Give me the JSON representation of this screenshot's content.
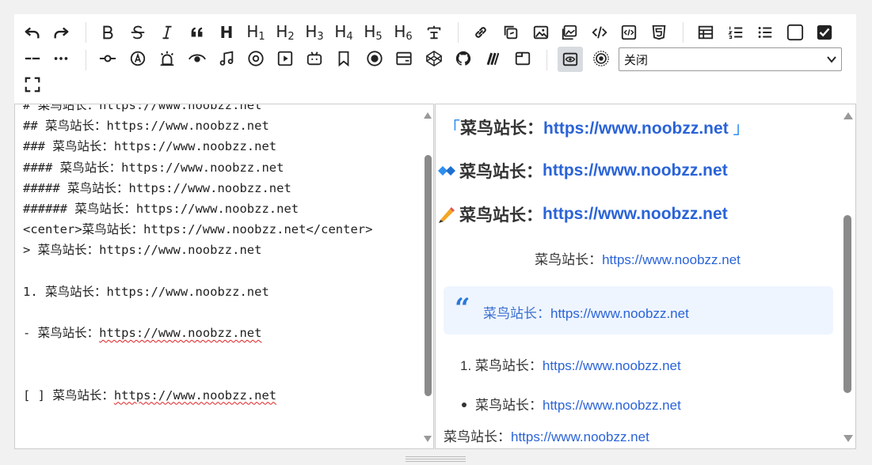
{
  "toolbar": {
    "mode_select": {
      "selected": "关闭"
    },
    "heading_labels": [
      "H",
      "1",
      "2",
      "3",
      "4",
      "5",
      "6"
    ]
  },
  "editor": {
    "lines": [
      "# 菜鸟站长：https://www.noobzz.net",
      "## 菜鸟站长：https://www.noobzz.net",
      "### 菜鸟站长：https://www.noobzz.net",
      "#### 菜鸟站长：https://www.noobzz.net",
      "##### 菜鸟站长：https://www.noobzz.net",
      "###### 菜鸟站长：https://www.noobzz.net",
      "<center>菜鸟站长：https://www.noobzz.net</center>",
      "> 菜鸟站长：https://www.noobzz.net",
      "",
      "1. 菜鸟站长：https://www.noobzz.net",
      "",
      "- 菜鸟站长：https://www.noobzz.net",
      "",
      "",
      "[ ] 菜鸟站长：https://www.noobzz.net"
    ],
    "list_prefix": "- 菜鸟站长：",
    "task_prefix": "[ ] 菜鸟站长：",
    "url": "https://www.noobzz.net"
  },
  "preview": {
    "label": "菜鸟站长：",
    "url": "https://www.noobzz.net",
    "bracket_open": "「",
    "bracket_close": "」",
    "quote_mark": "“",
    "ol_number": "1.",
    "colors": {
      "link": "#2a63d8",
      "accent": "#2f8ff0",
      "quote_bg": "#eef5ff"
    }
  }
}
